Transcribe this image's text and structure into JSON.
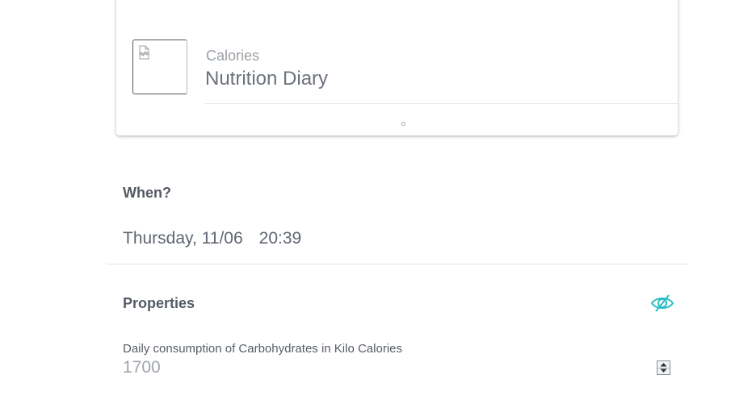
{
  "card": {
    "subtitle": "Calories",
    "title": "Nutrition Diary",
    "image_state": "broken-image-icon"
  },
  "when": {
    "label": "When?",
    "date": "Thursday, 11/06",
    "time": "20:39"
  },
  "properties": {
    "label": "Properties",
    "visibility_icon": "eye-off-icon",
    "fields": [
      {
        "label": "Daily consumption of Carbohydrates in Kilo Calories",
        "value": "1700"
      }
    ]
  },
  "colors": {
    "accent": "#2bbcc6",
    "text": "#5f6670",
    "muted": "#9aa0a6"
  }
}
